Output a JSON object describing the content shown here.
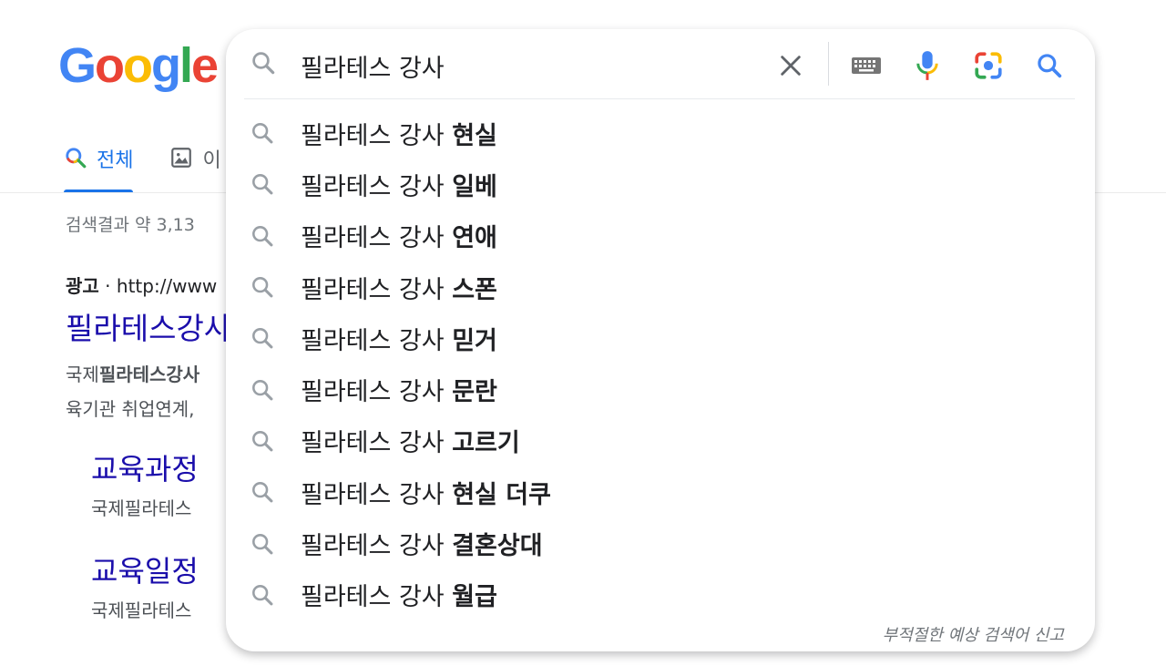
{
  "logo": {
    "letters": [
      "G",
      "o",
      "o",
      "g",
      "l",
      "e"
    ],
    "colors": [
      "#4285F4",
      "#EA4335",
      "#FBBC05",
      "#4285F4",
      "#34A853",
      "#EA4335"
    ]
  },
  "tabs": [
    {
      "label": "전체",
      "icon": "search-icon",
      "active": true
    },
    {
      "label": "이",
      "icon": "image-icon",
      "active": false
    }
  ],
  "results": {
    "stats": "검색결과 약 3,13",
    "ad": {
      "label": "광고",
      "sep": " · ",
      "url": "http://www",
      "title": "필라테스강사",
      "desc_line1_prefix": "국제",
      "desc_line1_bold": "필라테스강사",
      "desc_line2": "육기관 취업연계,"
    },
    "sitelinks": [
      {
        "title": "교육과정",
        "desc": "국제필라테스"
      },
      {
        "title": "교육일정",
        "desc": "국제필라테스"
      }
    ]
  },
  "search": {
    "query": "필라테스 강사",
    "clear_icon": "close-icon",
    "keyboard_icon": "keyboard-icon",
    "mic_icon": "microphone-icon",
    "lens_icon": "camera-icon",
    "submit_icon": "search-icon"
  },
  "suggestions": [
    {
      "base": "필라테스 강사 ",
      "rest": "현실"
    },
    {
      "base": "필라테스 강사 ",
      "rest": "일베"
    },
    {
      "base": "필라테스 강사 ",
      "rest": "연애"
    },
    {
      "base": "필라테스 강사 ",
      "rest": "스폰"
    },
    {
      "base": "필라테스 강사 ",
      "rest": "믿거"
    },
    {
      "base": "필라테스 강사 ",
      "rest": "문란"
    },
    {
      "base": "필라테스 강사 ",
      "rest": "고르기"
    },
    {
      "base": "필라테스 강사 ",
      "rest": "현실 더쿠"
    },
    {
      "base": "필라테스 강사 ",
      "rest": "결혼상대"
    },
    {
      "base": "필라테스 강사 ",
      "rest": "월급"
    }
  ],
  "report_link": "부적절한 예상 검색어 신고",
  "colors": {
    "link": "#1a0dab",
    "accent": "#1a73e8",
    "muted": "#70757a",
    "icon_gray": "#9aa0a6"
  }
}
